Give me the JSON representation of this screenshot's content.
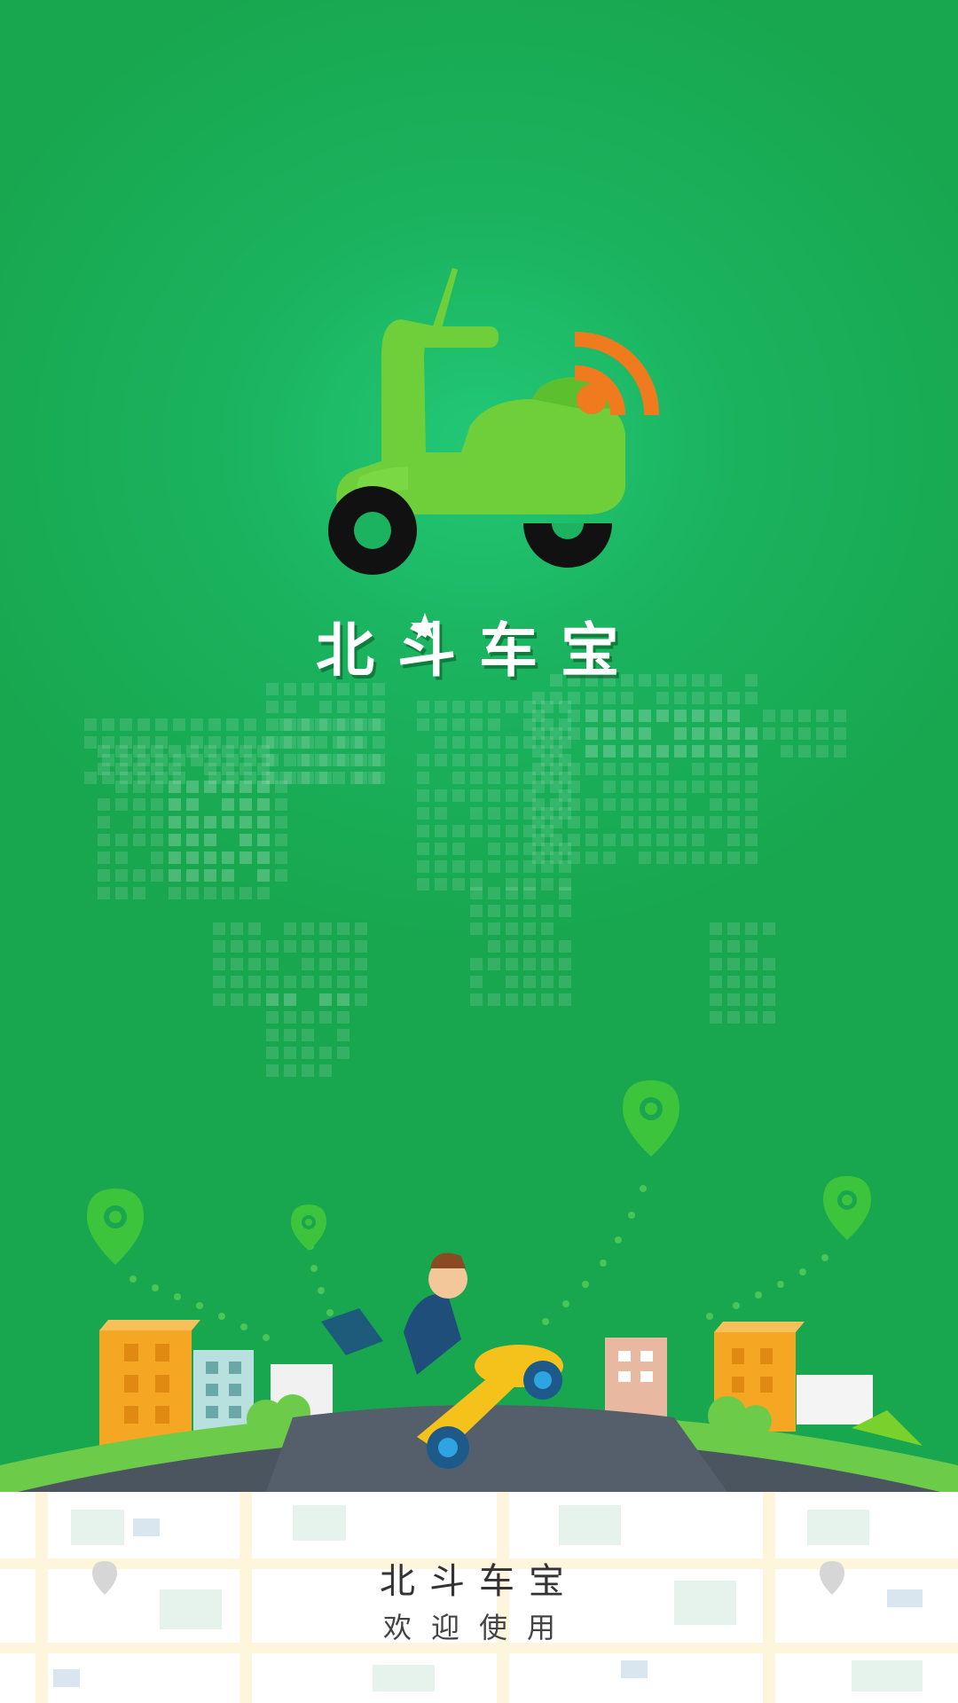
{
  "brand": {
    "title": "北斗车宝"
  },
  "footer": {
    "title": "北斗车宝",
    "subtitle": "欢迎使用"
  },
  "icons": {
    "logo": "scooter-signal-icon",
    "pins": "location-pin-icon",
    "rider": "scooter-rider-illustration"
  },
  "colors": {
    "background": "#1aa64f",
    "logo_green": "#6fcf3a",
    "signal_orange": "#f07a1e",
    "wheel": "#111111",
    "footer_bg": "#ffffff"
  }
}
